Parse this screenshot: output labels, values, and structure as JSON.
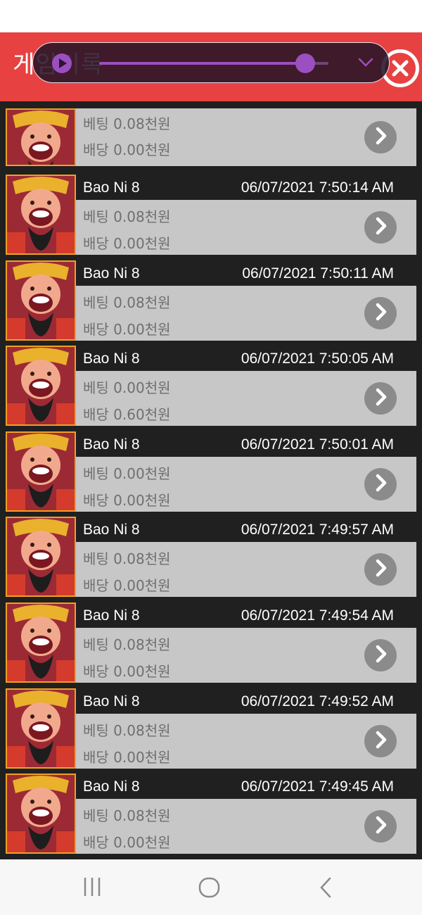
{
  "header": {
    "title": "게임기록"
  },
  "player": {
    "progress": 0.9
  },
  "records": [
    {
      "name": "",
      "time": "",
      "bet_label": "베팅",
      "bet": "0.08천원",
      "payout_label": "배당",
      "payout": "0.00천원"
    },
    {
      "name": "Bao Ni 8",
      "time": "06/07/2021 7:50:14 AM",
      "bet_label": "베팅",
      "bet": "0.08천원",
      "payout_label": "배당",
      "payout": "0.00천원"
    },
    {
      "name": "Bao Ni 8",
      "time": "06/07/2021 7:50:11 AM",
      "bet_label": "베팅",
      "bet": "0.08천원",
      "payout_label": "배당",
      "payout": "0.00천원"
    },
    {
      "name": "Bao Ni 8",
      "time": "06/07/2021 7:50:05 AM",
      "bet_label": "베팅",
      "bet": "0.00천원",
      "payout_label": "배당",
      "payout": "0.60천원"
    },
    {
      "name": "Bao Ni 8",
      "time": "06/07/2021 7:50:01 AM",
      "bet_label": "베팅",
      "bet": "0.00천원",
      "payout_label": "배당",
      "payout": "0.00천원"
    },
    {
      "name": "Bao Ni 8",
      "time": "06/07/2021 7:49:57 AM",
      "bet_label": "베팅",
      "bet": "0.08천원",
      "payout_label": "배당",
      "payout": "0.00천원"
    },
    {
      "name": "Bao Ni 8",
      "time": "06/07/2021 7:49:54 AM",
      "bet_label": "베팅",
      "bet": "0.08천원",
      "payout_label": "배당",
      "payout": "0.00천원"
    },
    {
      "name": "Bao Ni 8",
      "time": "06/07/2021 7:49:52 AM",
      "bet_label": "베팅",
      "bet": "0.08천원",
      "payout_label": "배당",
      "payout": "0.00천원"
    },
    {
      "name": "Bao Ni 8",
      "time": "06/07/2021 7:49:45 AM",
      "bet_label": "베팅",
      "bet": "0.08천원",
      "payout_label": "배당",
      "payout": "0.00천원"
    }
  ],
  "icons": {
    "play": "play-icon",
    "collapse": "chevron-down-icon",
    "close": "close-icon",
    "detail": "chevron-right-icon",
    "thumbnail": "game-thumbnail",
    "nav_recents": "recents-icon",
    "nav_home": "home-icon",
    "nav_back": "back-icon"
  },
  "colors": {
    "header": "#e84141",
    "accent": "#9c4fc0",
    "row_body": "#c7c7c7",
    "thumb_border": "#f0a11f"
  }
}
